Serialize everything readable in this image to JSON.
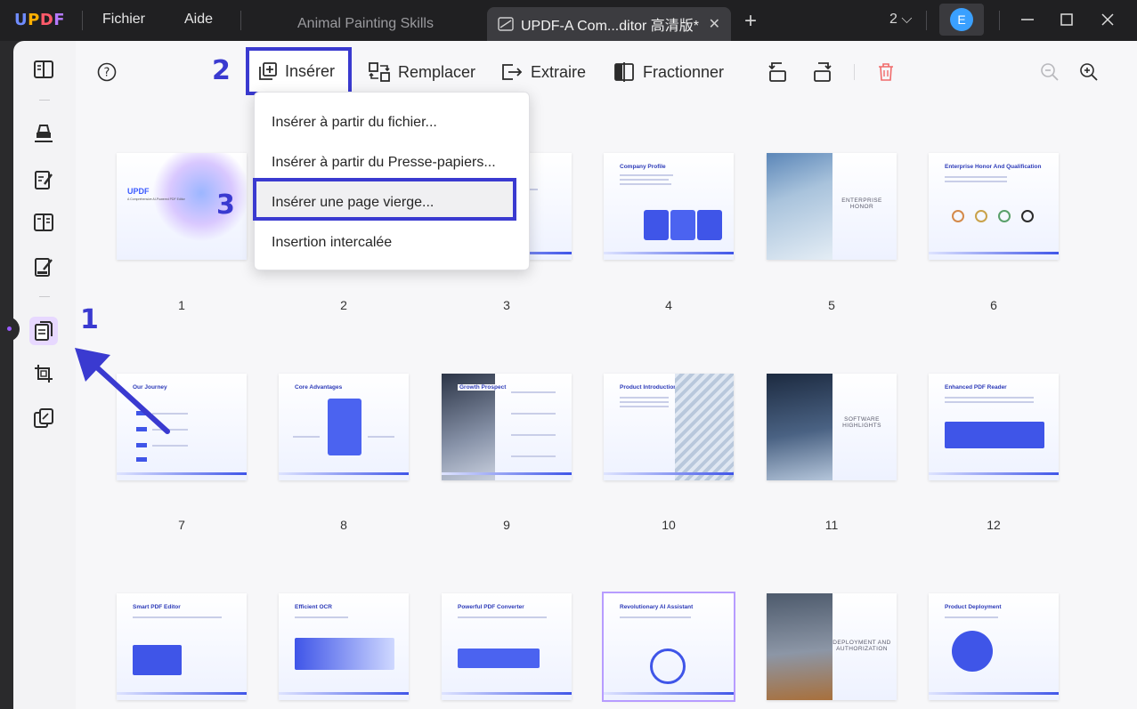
{
  "app": {
    "logo": "UPDF"
  },
  "menu": {
    "file": "Fichier",
    "help": "Aide"
  },
  "tabs": [
    {
      "label": "Animal Painting Skills"
    },
    {
      "label": "UPDF-A Com...ditor 高清版*"
    }
  ],
  "window": {
    "count": "2",
    "avatar_initial": "E"
  },
  "toolbar": {
    "insert": "Insérer",
    "replace": "Remplacer",
    "extract": "Extraire",
    "split": "Fractionner"
  },
  "dropdown": {
    "items": [
      "Insérer à partir du fichier...",
      "Insérer à partir du Presse-papiers...",
      "Insérer une page vierge...",
      "Insertion intercalée"
    ]
  },
  "annotations": {
    "step1": "1",
    "step2": "2",
    "step3": "3"
  },
  "pages": [
    {
      "num": "1",
      "title": "UPDF",
      "subtitle": "A Comprehensive AI-Powered PDF Editor"
    },
    {
      "num": "2",
      "title": ""
    },
    {
      "num": "3",
      "title": ""
    },
    {
      "num": "4",
      "title": "Company Profile"
    },
    {
      "num": "5",
      "title": "",
      "side": "ENTERPRISE HONOR"
    },
    {
      "num": "6",
      "title": "Enterprise Honor And Qualification"
    },
    {
      "num": "7",
      "title": "Our Journey"
    },
    {
      "num": "8",
      "title": "Core Advantages"
    },
    {
      "num": "9",
      "title": "Growth Prospect"
    },
    {
      "num": "10",
      "title": "Product Introduction"
    },
    {
      "num": "11",
      "title": "",
      "side": "SOFTWARE HIGHLIGHTS"
    },
    {
      "num": "12",
      "title": "Enhanced PDF Reader"
    },
    {
      "num": "",
      "title": "Smart PDF Editor"
    },
    {
      "num": "",
      "title": "Efficient OCR"
    },
    {
      "num": "",
      "title": "Powerful PDF Converter"
    },
    {
      "num": "",
      "title": "Revolutionary AI Assistant"
    },
    {
      "num": "",
      "title": "",
      "side": "DEPLOYMENT AND AUTHORIZATION"
    },
    {
      "num": "",
      "title": "Product Deployment"
    }
  ],
  "colors": {
    "accent": "#3a3ad0",
    "rail_active": "#e7d8ff",
    "brand_blue": "#2d3bb8"
  }
}
